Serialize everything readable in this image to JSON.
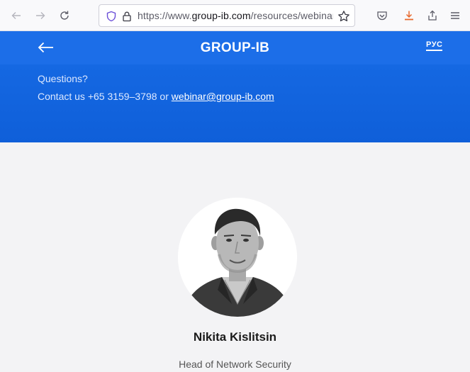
{
  "browser": {
    "url_prefix": "https://www.",
    "url_host": "group-ib.com",
    "url_path": "/resources/webinar"
  },
  "header": {
    "logo": "GROUP-IB",
    "lang": "РУС"
  },
  "contact": {
    "questions": "Questions?",
    "prefix": "Contact us +65 3159–3798 or ",
    "email": "webinar@group-ib.com"
  },
  "speaker": {
    "name": "Nikita Kislitsin",
    "role": "Head of Network Security"
  },
  "colors": {
    "header_blue": "#1c6ee8",
    "band_blue": "#1568e2",
    "download_accent": "#e8682c"
  }
}
